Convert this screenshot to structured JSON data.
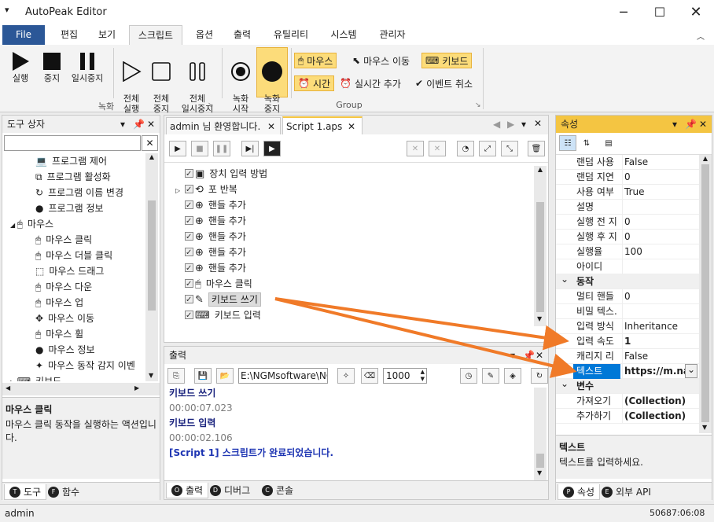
{
  "app": {
    "title": "AutoPeak Editor"
  },
  "menu": {
    "file": "File",
    "items": [
      "편집",
      "보기",
      "스크립트",
      "옵션",
      "출력",
      "유틸리티",
      "시스템",
      "관리자"
    ]
  },
  "ribbon": {
    "rec_group": "녹화",
    "group2": "Group",
    "run": "실행",
    "stop": "중지",
    "pause": "일시중지",
    "all_run": "전체\n실행",
    "all_stop": "전체\n중지",
    "all_pause": "전체\n일시중지",
    "rec_start": "녹화\n시작",
    "rec_stop": "녹화\n중지",
    "mouse": "마우스",
    "mouse_move": "마우스 이동",
    "keyboard": "키보드",
    "time": "시간",
    "realtime_add": "실시간 추가",
    "event_cancel": "이벤트 취소"
  },
  "toolbox": {
    "title": "도구 상자",
    "items": [
      {
        "label": "프로그램 제어",
        "indent": 2
      },
      {
        "label": "프로그램 활성화",
        "indent": 2
      },
      {
        "label": "프로그램 이름 변경",
        "indent": 2
      },
      {
        "label": "프로그램 정보",
        "indent": 2
      },
      {
        "label": "마우스",
        "indent": 1
      },
      {
        "label": "마우스 클릭",
        "indent": 2
      },
      {
        "label": "마우스 더블 클릭",
        "indent": 2
      },
      {
        "label": "마우스 드래그",
        "indent": 2
      },
      {
        "label": "마우스 다운",
        "indent": 2
      },
      {
        "label": "마우스 업",
        "indent": 2
      },
      {
        "label": "마우스 이동",
        "indent": 2
      },
      {
        "label": "마우스 휠",
        "indent": 2
      },
      {
        "label": "마우스 정보",
        "indent": 2
      },
      {
        "label": "마우스 동작 감지 이벤",
        "indent": 2
      },
      {
        "label": "키보드",
        "indent": 1
      }
    ],
    "desc_title": "마우스 클릭",
    "desc_text": "마우스 클릭 동작을 실행하는 액션입니다.",
    "tabs": [
      "도구",
      "함수"
    ]
  },
  "editor": {
    "tabs": [
      "admin 님 환영합니다.",
      "Script 1.aps"
    ],
    "steps": [
      {
        "label": "장치 입력 방법",
        "expand": false
      },
      {
        "label": "포 반복",
        "expand": true
      },
      {
        "label": "핸들 추가",
        "expand": false
      },
      {
        "label": "핸들 추가",
        "expand": false
      },
      {
        "label": "핸들 추가",
        "expand": false
      },
      {
        "label": "핸들 추가",
        "expand": false
      },
      {
        "label": "핸들 추가",
        "expand": false
      },
      {
        "label": "마우스 클릭",
        "expand": false
      },
      {
        "label": "키보드 쓰기",
        "expand": false
      },
      {
        "label": "키보드 입력",
        "expand": false
      }
    ]
  },
  "output": {
    "title": "출력",
    "path": "E:\\NGMsoftware\\NG",
    "count": "1000",
    "lines": [
      {
        "text": "키보드 쓰기",
        "color": "#1a237e"
      },
      {
        "text": "00:00:07.023",
        "color": "#7a7a7a"
      },
      {
        "text": "키보드 입력",
        "color": "#1a237e"
      },
      {
        "text": "00:00:02.106",
        "color": "#7a7a7a"
      },
      {
        "text": "[Script 1] 스크립트가 완료되었습니다.",
        "color": "#1f36b3"
      }
    ],
    "tabs": [
      "출력",
      "디버그",
      "콘솔"
    ]
  },
  "props": {
    "title": "속성",
    "rows": [
      {
        "k": "랜덤 사용",
        "v": "False",
        "cat": false
      },
      {
        "k": "랜덤 지연",
        "v": "0",
        "cat": false
      },
      {
        "k": "사용 여부",
        "v": "True",
        "cat": false
      },
      {
        "k": "설명",
        "v": "",
        "cat": false
      },
      {
        "k": "실행 전 지",
        "v": "0",
        "cat": false
      },
      {
        "k": "실행 후 지",
        "v": "0",
        "cat": false
      },
      {
        "k": "실행율",
        "v": "100",
        "cat": false
      },
      {
        "k": "아이디",
        "v": "",
        "cat": false
      },
      {
        "k": "동작",
        "v": "",
        "cat": true
      },
      {
        "k": "멀티 핸들",
        "v": "0",
        "cat": false
      },
      {
        "k": "비밀 텍스.",
        "v": "",
        "cat": false
      },
      {
        "k": "입력 방식",
        "v": "Inheritance",
        "cat": false
      },
      {
        "k": "입력 속도",
        "v": "1",
        "cat": false,
        "bold": true
      },
      {
        "k": "캐리지 리",
        "v": "False",
        "cat": false
      },
      {
        "k": "텍스트",
        "v": "https://m.nav",
        "cat": false,
        "bold": true,
        "sel": true
      },
      {
        "k": "변수",
        "v": "",
        "cat": true
      },
      {
        "k": "가져오기",
        "v": "(Collection)",
        "cat": false,
        "bold": true
      },
      {
        "k": "추가하기",
        "v": "(Collection)",
        "cat": false,
        "bold": true
      }
    ],
    "desc_title": "텍스트",
    "desc_text": "텍스트를 입력하세요.",
    "tabs": [
      "속성",
      "외부 API"
    ]
  },
  "status": {
    "user": "admin",
    "time": "50687:06:08"
  },
  "colors": {
    "accent": "#2b5797",
    "highlight": "#fcdc7a",
    "arrow": "#f07a28",
    "selected": "#0078d7",
    "panel_active": "#f4c542"
  }
}
